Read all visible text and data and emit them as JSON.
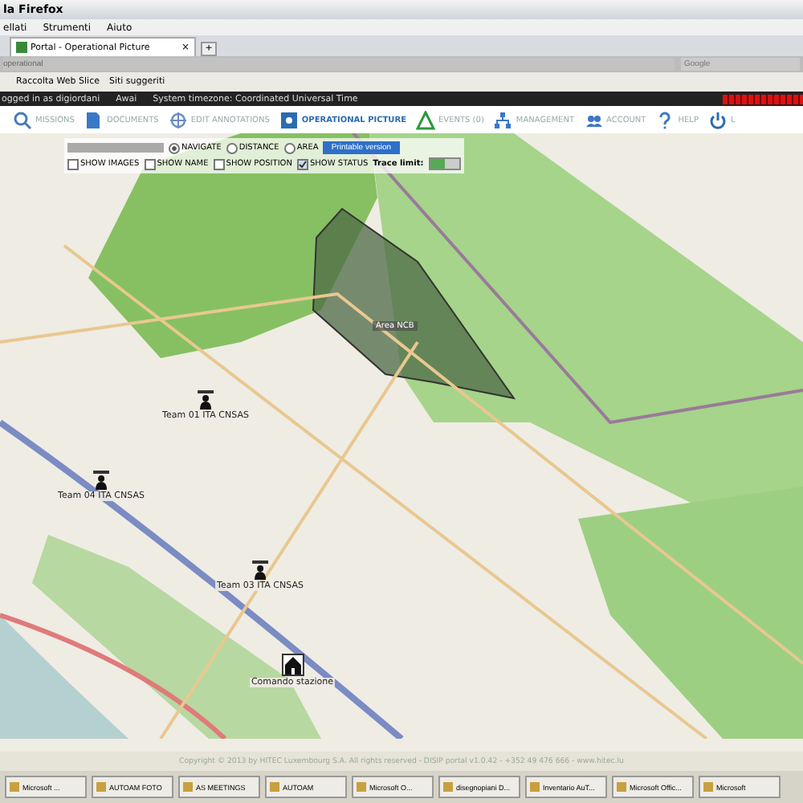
{
  "window": {
    "title": "la Firefox"
  },
  "menu": [
    "ellati",
    "Strumenti",
    "Aiuto"
  ],
  "tab": {
    "title": "Portal - Operational Picture",
    "close": "×",
    "new": "+"
  },
  "address": {
    "value": "operational"
  },
  "search": {
    "placeholder": "Google"
  },
  "bookmarks": [
    "Raccolta Web Slice",
    "Siti suggeriti"
  ],
  "status": {
    "user": "ogged in as digiordani",
    "logout": "Awai",
    "timezone": "System timezone: Coordinated Universal Time"
  },
  "nav": [
    {
      "label": "MISSIONS",
      "selected": false
    },
    {
      "label": "DOCUMENTS",
      "selected": false
    },
    {
      "label": "EDIT ANNOTATIONS",
      "selected": false
    },
    {
      "label": "OPERATIONAL PICTURE",
      "selected": true
    },
    {
      "label": "EVENTS (0)",
      "selected": false
    },
    {
      "label": "MANAGEMENT",
      "selected": false
    },
    {
      "label": "ACCOUNT",
      "selected": false
    },
    {
      "label": "HELP",
      "selected": false
    },
    {
      "label": "L",
      "selected": false
    }
  ],
  "modes": [
    {
      "label": "NAVIGATE",
      "selected": true
    },
    {
      "label": "DISTANCE",
      "selected": false
    },
    {
      "label": "AREA",
      "selected": false
    }
  ],
  "print_button": "Printable version",
  "options": [
    {
      "label": "SHOW IMAGES",
      "checked": false
    },
    {
      "label": "SHOW NAME",
      "checked": false
    },
    {
      "label": "SHOW POSITION",
      "checked": false
    },
    {
      "label": "SHOW STATUS",
      "checked": true
    }
  ],
  "trace": {
    "label": "Trace limit:",
    "level": 0.5
  },
  "map": {
    "area_label": "Area NCB",
    "markers": [
      {
        "kind": "team",
        "label": "Team 01 ITA CNSAS"
      },
      {
        "kind": "team",
        "label": "Team 04 ITA CNSAS"
      },
      {
        "kind": "team",
        "label": "Team 03 ITA CNSAS"
      },
      {
        "kind": "base",
        "label": "Comando stazione"
      }
    ]
  },
  "footer": "Copyright © 2013 by HITEC Luxembourg S.A. All rights reserved - DISIP portal v1.0.42 - +352 49 476 666 - www.hitec.lu",
  "taskbar": [
    "Microsoft ...",
    "AUTOAM FOTO",
    "AS MEETINGS",
    "AUTOAM",
    "Microsoft O...",
    "disegnopiani D...",
    "Inventario AuT...",
    "Microsoft Offic...",
    "Microsoft"
  ]
}
